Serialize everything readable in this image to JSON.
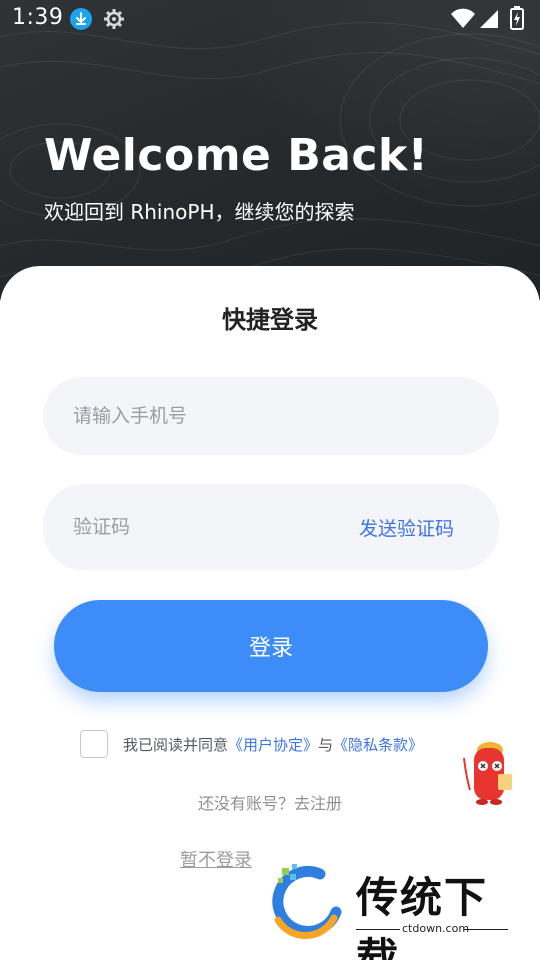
{
  "status_bar": {
    "time": "1:39",
    "icons": [
      "download-icon",
      "gear-icon",
      "wifi-icon",
      "signal-icon",
      "battery-icon"
    ]
  },
  "hero": {
    "title": "Welcome Back!",
    "subtitle": "欢迎回到 RhinoPH，继续您的探索"
  },
  "login": {
    "title": "快捷登录",
    "phone_placeholder": "请输入手机号",
    "code_placeholder": "验证码",
    "send_code_label": "发送验证码",
    "submit_label": "登录",
    "agreement": {
      "prefix": "我已阅读并同意",
      "user_agreement": "《用户协定》",
      "conjunction": "与",
      "privacy_policy": "《隐私条款》",
      "checked": false
    },
    "register_label": "还没有账号？去注册",
    "skip_label": "暂不登录"
  },
  "watermark": {
    "text": "传统下载",
    "url": "ctdown.com"
  },
  "colors": {
    "accent": "#3d8cf7",
    "link": "#3c74e6",
    "hero_bg": "#2a2e31",
    "field_bg": "#f4f5f8"
  }
}
